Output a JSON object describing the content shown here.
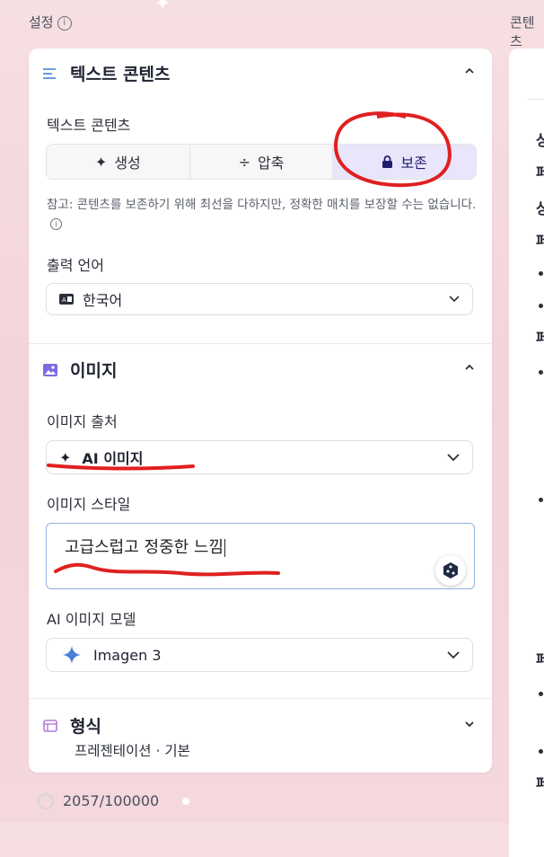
{
  "header": {
    "settings_label": "설정",
    "content_label": "콘텐츠"
  },
  "text_section": {
    "title": "텍스트 콘텐츠",
    "field_label": "텍스트 콘텐츠",
    "options": [
      "생성",
      "압축",
      "보존"
    ],
    "selected": "보존",
    "note": "참고: 콘텐츠를 보존하기 위해 최선을 다하지만, 정확한 매치를 보장할 수는 없습니다.",
    "language_label": "출력 언어",
    "language_value": "한국어"
  },
  "image_section": {
    "title": "이미지",
    "source_label": "이미지 출처",
    "source_value": "AI 이미지",
    "style_label": "이미지 스타일",
    "style_value": "고급스럽고 정중한 느낌",
    "model_label": "AI 이미지 모델",
    "model_value": "Imagen 3"
  },
  "format_section": {
    "title": "형식",
    "value": "프레젠테이션 · 기본"
  },
  "footer": {
    "counter": "2057/100000"
  },
  "colors": {
    "accent": "#e9e6fb",
    "annotation": "#e02020",
    "link_blue": "#4a7fd4"
  }
}
